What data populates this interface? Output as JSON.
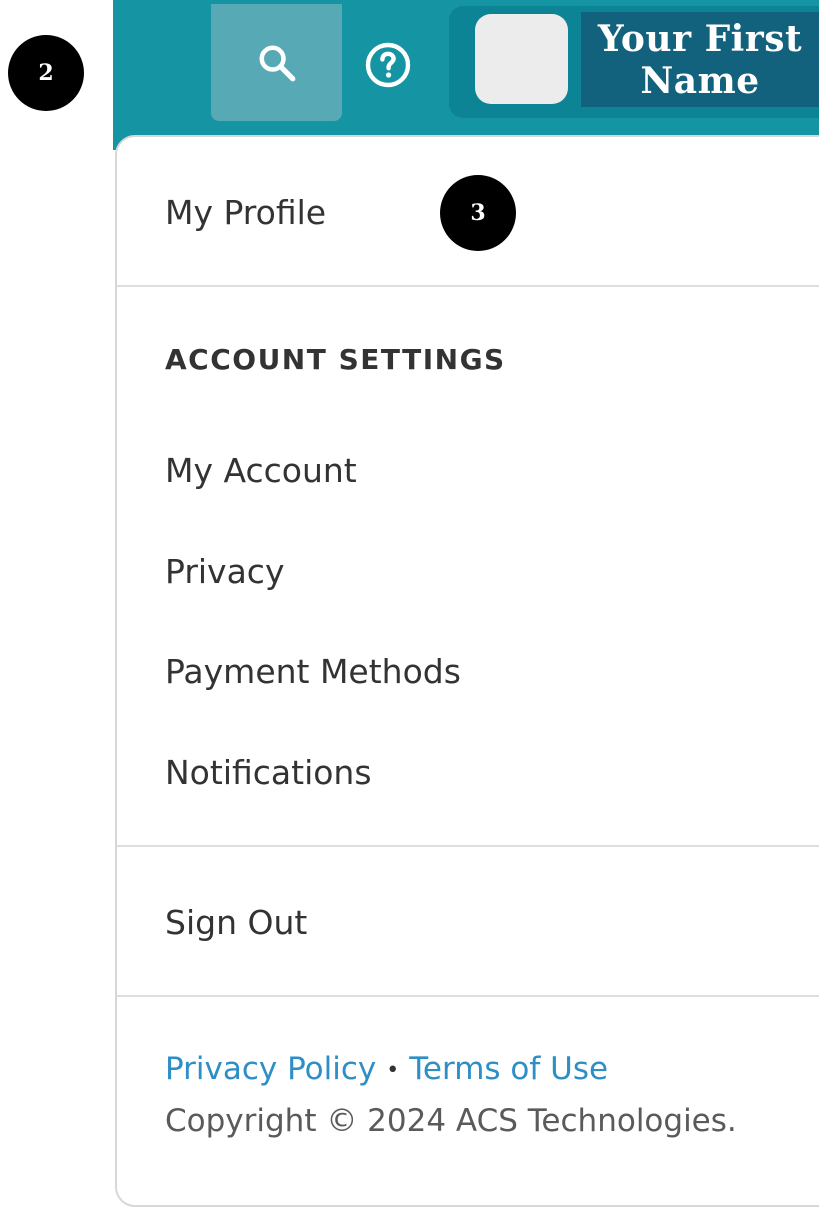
{
  "callouts": {
    "first": "2",
    "second": "3"
  },
  "header": {
    "search_icon": "search-icon",
    "help_icon": "help-circle-icon",
    "user_name": "Your First\nName"
  },
  "menu": {
    "profile_label": "My Profile",
    "account_settings_heading": "ACCOUNT SETTINGS",
    "items": [
      {
        "label": "My Account"
      },
      {
        "label": "Privacy"
      },
      {
        "label": "Payment Methods"
      },
      {
        "label": "Notifications"
      }
    ],
    "sign_out_label": "Sign Out"
  },
  "footer": {
    "privacy_policy": "Privacy Policy",
    "terms_of_use": "Terms of Use",
    "separator": "•",
    "copyright": "Copyright © 2024 ACS Technologies."
  },
  "colors": {
    "header_bg": "#1594a3",
    "search_active_bg": "#57aab5",
    "user_area_bg": "#0c8495",
    "name_bg": "#12627d",
    "link_color": "#2d8fc6"
  }
}
